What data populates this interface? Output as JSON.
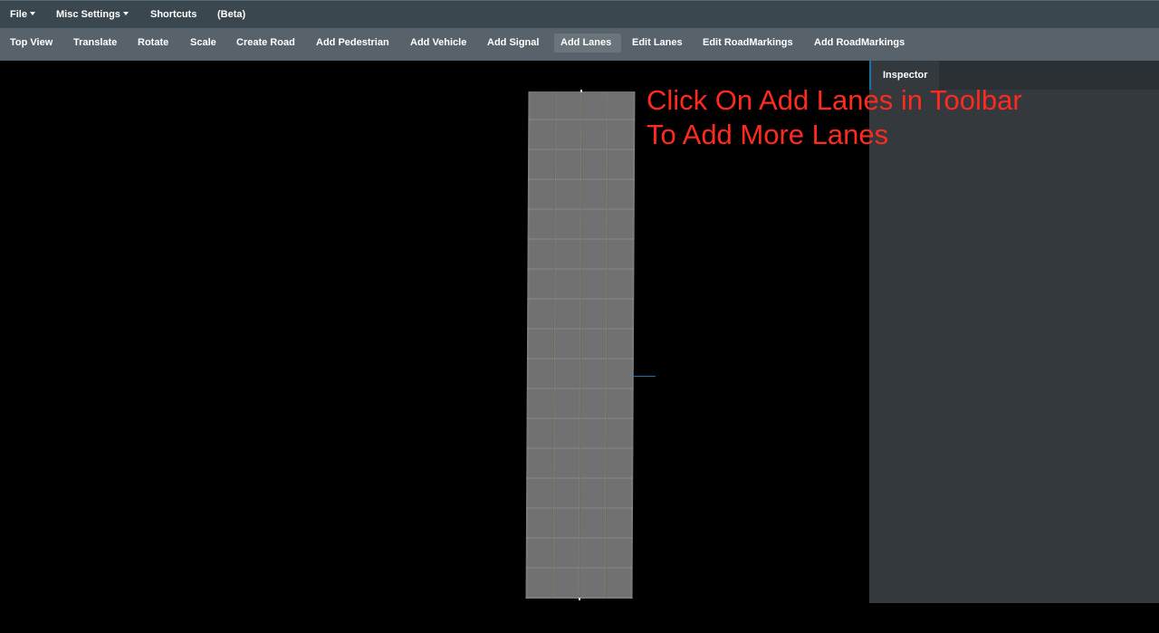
{
  "menubar": {
    "items": [
      {
        "label": "File",
        "dropdown": true
      },
      {
        "label": "Misc Settings",
        "dropdown": true
      },
      {
        "label": "Shortcuts",
        "dropdown": false
      },
      {
        "label": "(Beta)",
        "dropdown": false
      }
    ]
  },
  "toolbar": {
    "active": "Add Lanes",
    "items": [
      {
        "label": "Top View"
      },
      {
        "label": "Translate"
      },
      {
        "label": "Rotate"
      },
      {
        "label": "Scale"
      },
      {
        "label": "Create Road"
      },
      {
        "label": "Add Pedestrian"
      },
      {
        "label": "Add Vehicle"
      },
      {
        "label": "Add Signal"
      },
      {
        "label": "Add Lanes"
      },
      {
        "label": "Edit Lanes"
      },
      {
        "label": "Edit RoadMarkings"
      },
      {
        "label": "Add RoadMarkings"
      }
    ]
  },
  "viewport": {
    "hint_line1": "Click On Add Lanes in Toolbar",
    "hint_line2": "To Add More Lanes",
    "hint_color": "#ff2a1f",
    "road_lanes": 4
  },
  "inspector": {
    "tab_label": "Inspector"
  },
  "colors": {
    "menubar_bg": "#3b474f",
    "toolbar_bg": "#58626a",
    "inspector_bg": "#33393d",
    "accent": "#1d6fa5"
  }
}
